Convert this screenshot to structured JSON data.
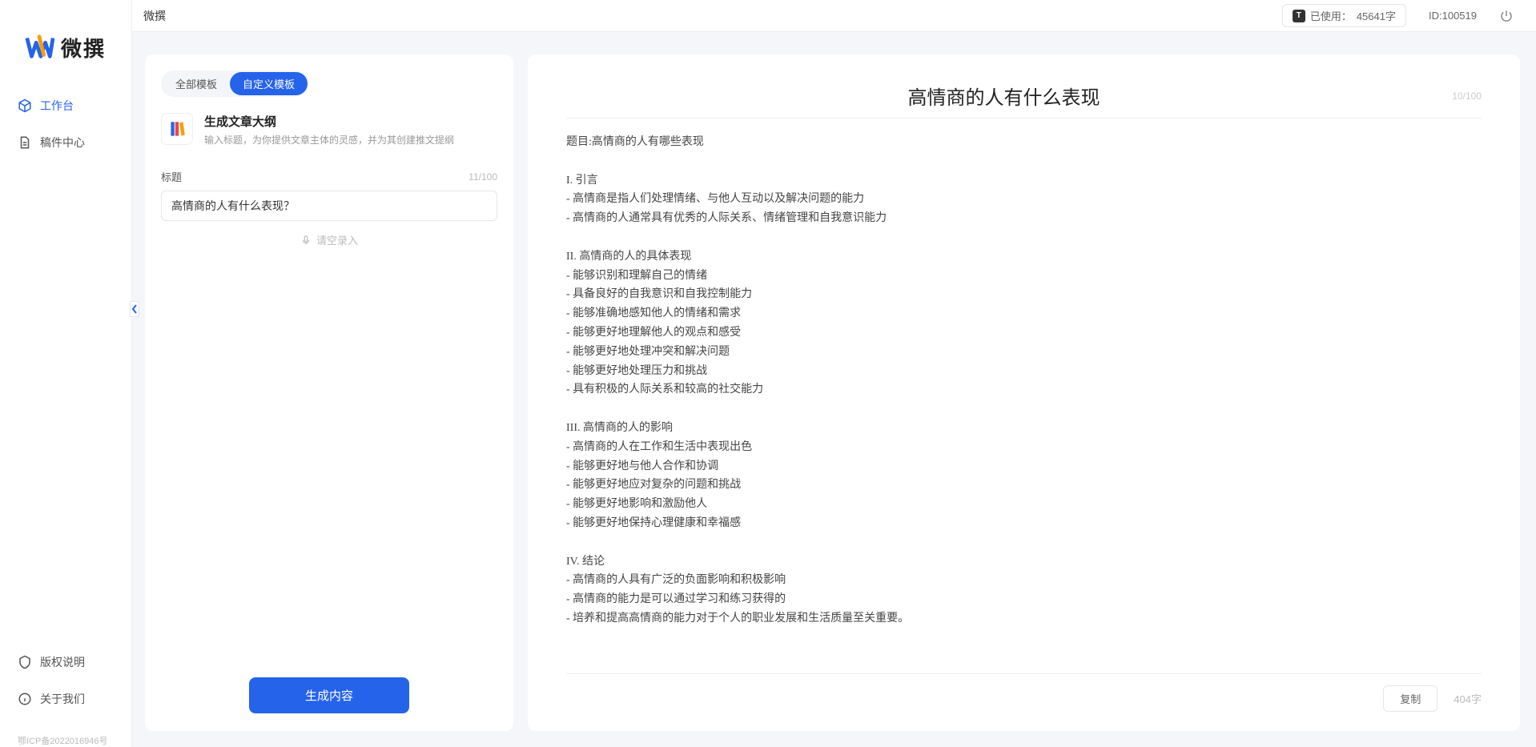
{
  "brand": {
    "name": "微撰"
  },
  "sidebar": {
    "nav": [
      {
        "label": "工作台",
        "active": true
      },
      {
        "label": "稿件中心",
        "active": false
      }
    ],
    "bottom": [
      {
        "label": "版权说明"
      },
      {
        "label": "关于我们"
      }
    ],
    "icp": "鄂ICP备2022016946号"
  },
  "topbar": {
    "title": "微撰",
    "usage_label": "已使用：",
    "usage_value": "45641字",
    "id_label": "ID:",
    "id_value": "100519"
  },
  "left": {
    "tabs": [
      {
        "label": "全部模板",
        "active": false
      },
      {
        "label": "自定义模板",
        "active": true
      }
    ],
    "template": {
      "title": "生成文章大纲",
      "desc": "输入标题，为你提供文章主体的灵感，并为其创建推文提纲"
    },
    "title_field": {
      "label": "标题",
      "counter": "11/100",
      "value": "高情商的人有什么表现？"
    },
    "voice_hint": "请空录入",
    "generate_label": "生成内容"
  },
  "right": {
    "title": "高情商的人有什么表现",
    "title_counter": "10/100",
    "body": "题目:高情商的人有哪些表现\n\nI. 引言\n- 高情商是指人们处理情绪、与他人互动以及解决问题的能力\n- 高情商的人通常具有优秀的人际关系、情绪管理和自我意识能力\n\nII. 高情商的人的具体表现\n- 能够识别和理解自己的情绪\n- 具备良好的自我意识和自我控制能力\n- 能够准确地感知他人的情绪和需求\n- 能够更好地理解他人的观点和感受\n- 能够更好地处理冲突和解决问题\n- 能够更好地处理压力和挑战\n- 具有积极的人际关系和较高的社交能力\n\nIII. 高情商的人的影响\n- 高情商的人在工作和生活中表现出色\n- 能够更好地与他人合作和协调\n- 能够更好地应对复杂的问题和挑战\n- 能够更好地影响和激励他人\n- 能够更好地保持心理健康和幸福感\n\nIV. 结论\n- 高情商的人具有广泛的负面影响和积极影响\n- 高情商的能力是可以通过学习和练习获得的\n- 培养和提高高情商的能力对于个人的职业发展和生活质量至关重要。",
    "copy_label": "复制",
    "word_count": "404字"
  }
}
